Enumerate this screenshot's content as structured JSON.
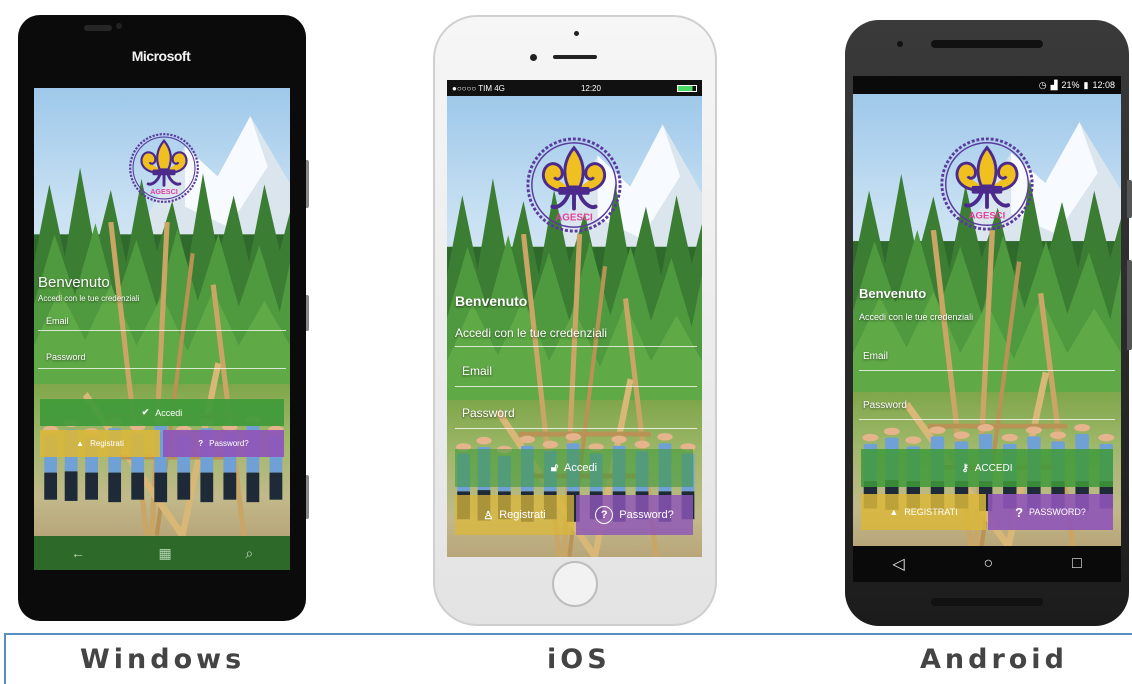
{
  "windows": {
    "brand": "Microsoft",
    "welcome": "Benvenuto",
    "subtitle": "Accedi con le tue credenziali",
    "email_label": "Email",
    "password_label": "Password",
    "login_label": "Accedi",
    "register_label": "Registrati",
    "forgot_label": "Password?",
    "nav_icons": [
      "back-arrow-icon",
      "windows-start-icon",
      "search-icon"
    ]
  },
  "ios": {
    "status": {
      "carrier": "●○○○○ TIM 4G",
      "time": "12:20"
    },
    "welcome": "Benvenuto",
    "subtitle": "Accedi con le tue credenziali",
    "email_label": "Email",
    "password_label": "Password",
    "login_label": "Accedi",
    "register_label": "Registrati",
    "forgot_label": "Password?"
  },
  "android": {
    "status": {
      "icons_text": "21%",
      "time": "12:08"
    },
    "welcome": "Benvenuto",
    "subtitle": "Accedi con le tue credenziali",
    "email_label": "Email",
    "password_label": "Password",
    "login_label": "ACCEDI",
    "register_label": "REGISTRATI",
    "forgot_label": "PASSWORD?",
    "nav_icons": [
      "back-triangle-icon",
      "home-circle-icon",
      "recents-square-icon"
    ]
  },
  "logo_text": "AGESCI",
  "captions": {
    "windows": "Windows",
    "ios": "iOS",
    "android": "Android"
  },
  "colors": {
    "green_button": "#3f9a3a",
    "yellow_button": "#d9b73a",
    "purple_button": "#8e55b8",
    "caption_rule": "#5a8ec2",
    "logo_purple": "#4b2a8c",
    "logo_yellow": "#f0c020"
  }
}
